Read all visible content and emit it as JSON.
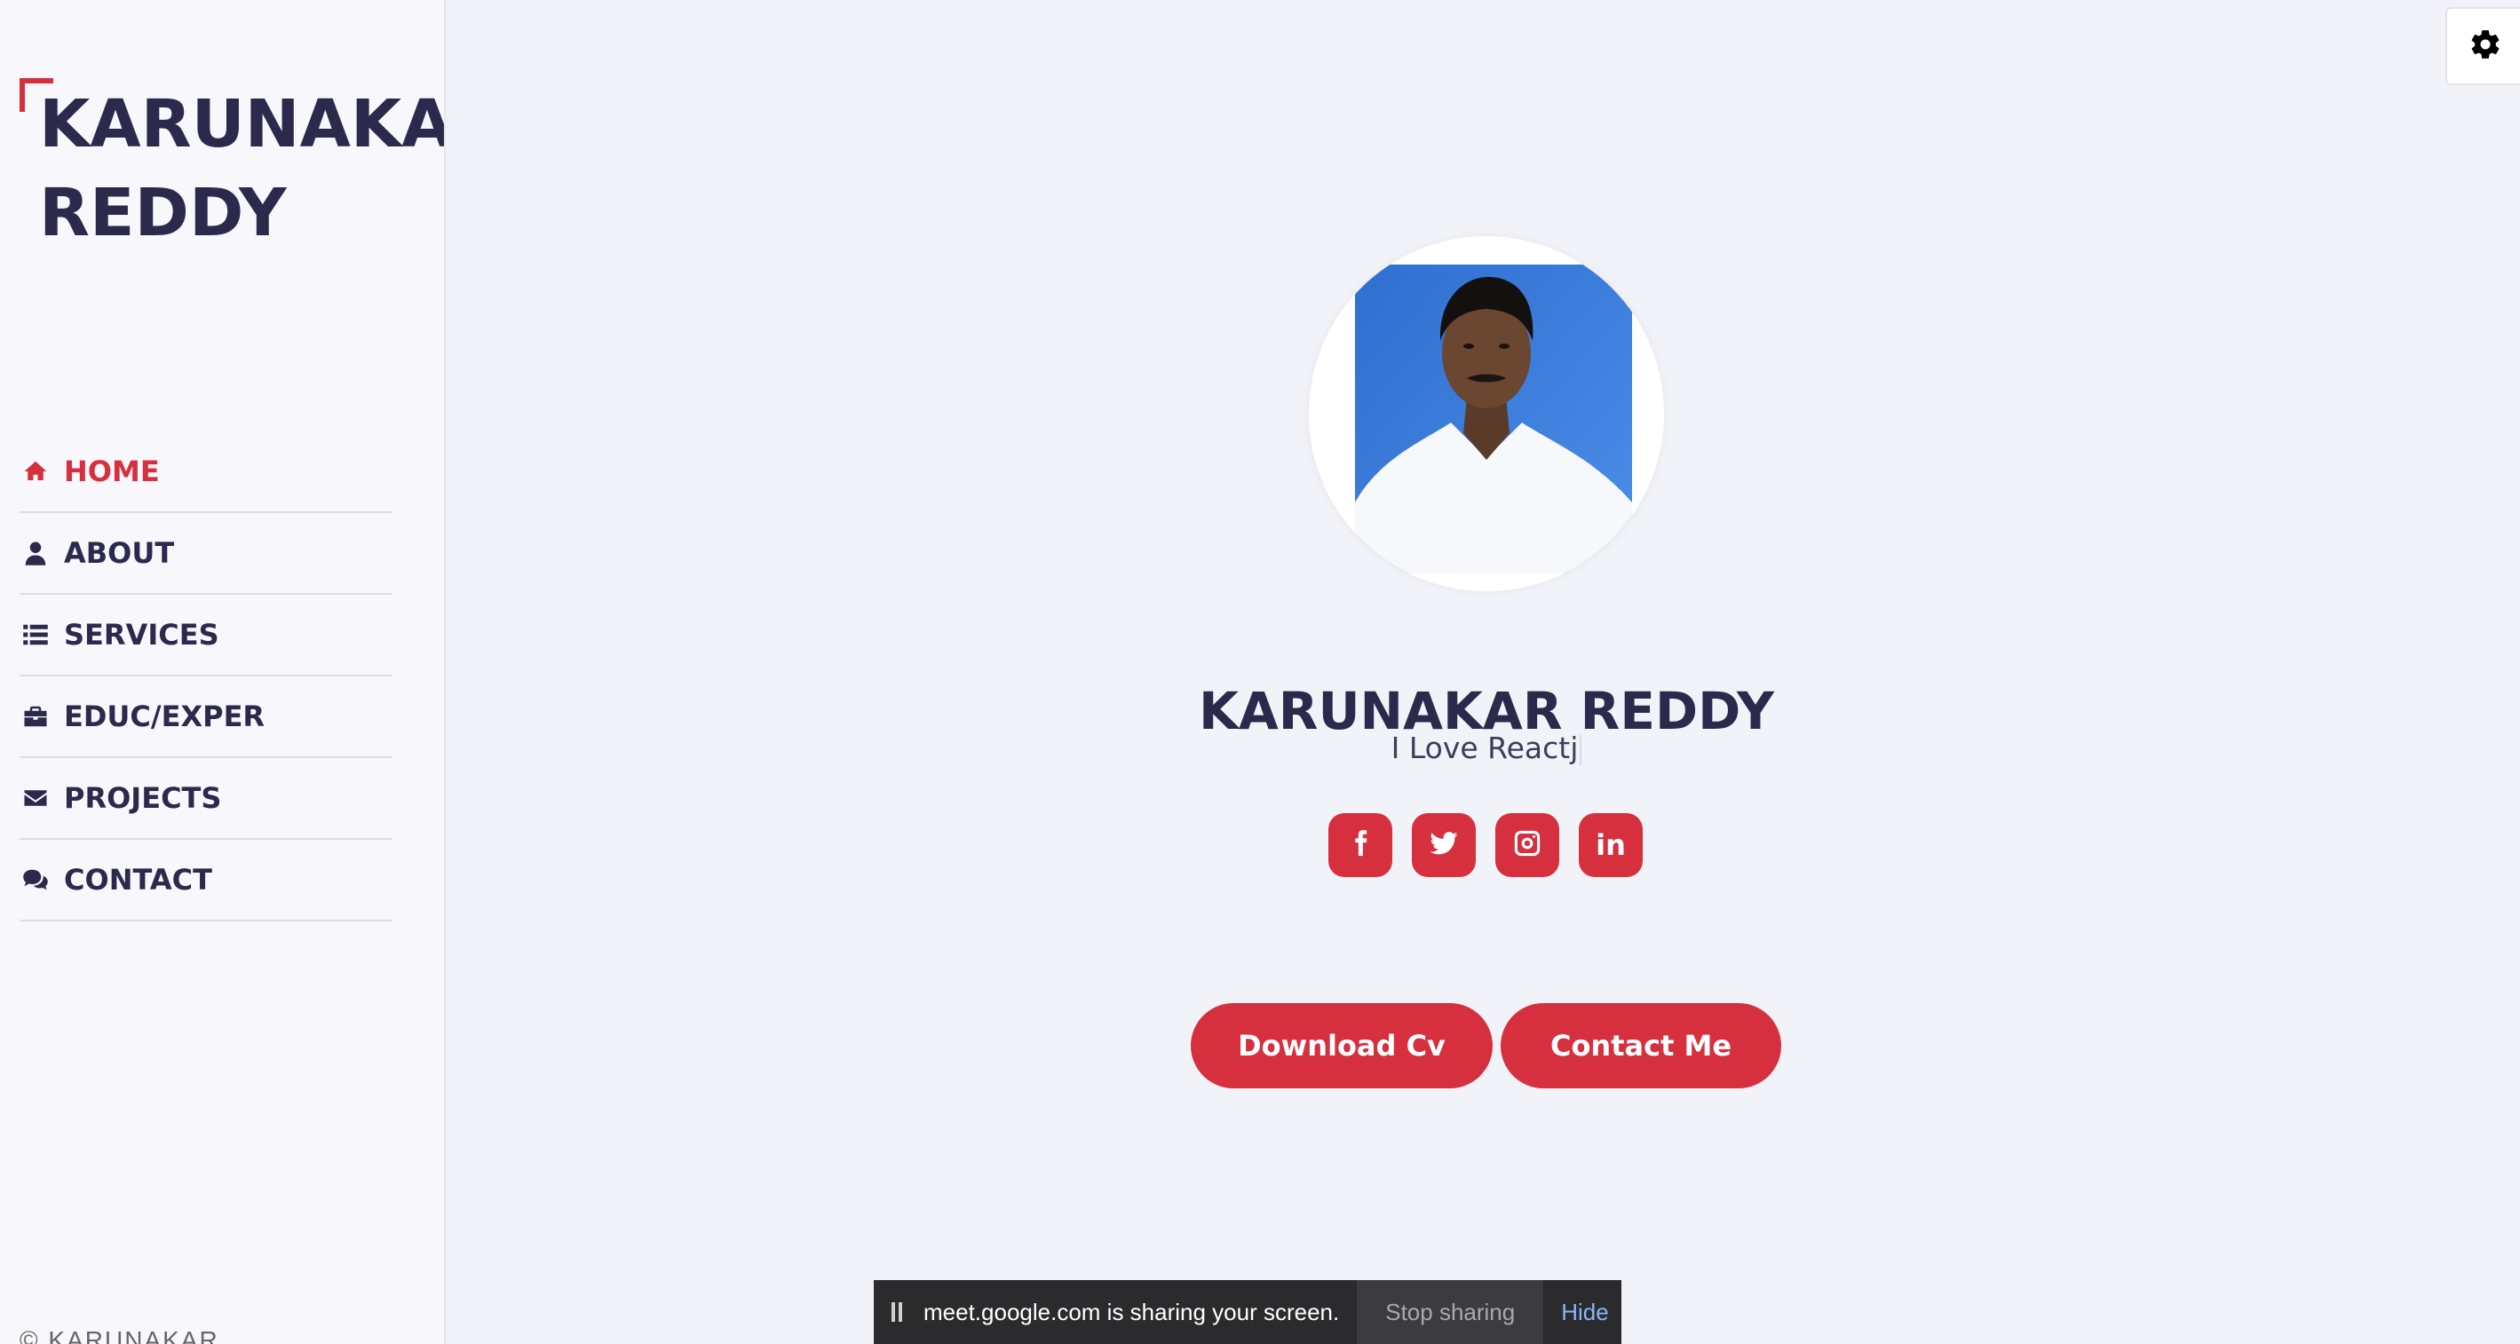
{
  "sidebar": {
    "brand": "KARUNAKAR REDDY",
    "nav": [
      {
        "label": "HOME",
        "icon": "home-icon",
        "active": true
      },
      {
        "label": "ABOUT",
        "icon": "user-icon",
        "active": false
      },
      {
        "label": "SERVICES",
        "icon": "list-icon",
        "active": false
      },
      {
        "label": "EDUC/EXPER",
        "icon": "briefcase-icon",
        "active": false
      },
      {
        "label": "PROJECTS",
        "icon": "envelope-icon",
        "active": false
      },
      {
        "label": "CONTACT",
        "icon": "comments-icon",
        "active": false
      }
    ],
    "copyright": "© KARUNAKAR"
  },
  "profile": {
    "name": "KARUNAKAR REDDY",
    "tagline": "I Love Reactj",
    "socials": [
      {
        "icon": "facebook-icon"
      },
      {
        "icon": "twitter-icon"
      },
      {
        "icon": "instagram-icon"
      },
      {
        "icon": "linkedin-icon",
        "text": "in"
      }
    ]
  },
  "actions": {
    "download_cv": "Download Cv",
    "contact_me": "Contact Me"
  },
  "share_bar": {
    "message": "meet.google.com is sharing your screen.",
    "stop_label": "Stop sharing",
    "hide_label": "Hide"
  },
  "colors": {
    "accent": "#d6303f",
    "text_dark": "#2b2a4c",
    "background": "#f2f3f9",
    "sidebar_bg": "#f8f7fc"
  }
}
